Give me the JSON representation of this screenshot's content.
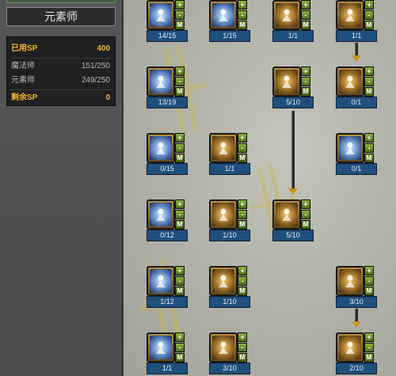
{
  "class_name": "元素师",
  "sp": {
    "used_label": "已用SP",
    "used_value": "400",
    "mage_label": "魔法师",
    "mage_value": "151/250",
    "elementalist_label": "元素师",
    "elementalist_value": "249/250",
    "remaining_label": "剩余SP",
    "remaining_value": "0"
  },
  "controls": {
    "plus": "+",
    "minus": "-",
    "master": "M"
  },
  "skills": [
    {
      "level": "14/15",
      "icon": "swirl-icon",
      "tone": "blue"
    },
    {
      "level": "1/15",
      "icon": "lightning-icon",
      "tone": "blue"
    },
    {
      "level": "1/1",
      "icon": "figure-icon",
      "tone": "gold"
    },
    {
      "level": "1/1",
      "icon": "figure-icon",
      "tone": "gold"
    },
    {
      "level": "13/19",
      "icon": "frost-star-icon",
      "tone": "blue"
    },
    {
      "level": "5/10",
      "icon": "fire-figure-icon",
      "tone": "gold"
    },
    {
      "level": "0/1",
      "icon": "orb-icon",
      "tone": "gold"
    },
    {
      "level": "0/15",
      "icon": "ghost-icon",
      "tone": "blue"
    },
    {
      "level": "1/1",
      "icon": "figure-icon",
      "tone": "gold"
    },
    {
      "level": "0/1",
      "icon": "runner-icon",
      "tone": "blue"
    },
    {
      "level": "0/12",
      "icon": "ice-pillar-icon",
      "tone": "blue"
    },
    {
      "level": "1/10",
      "icon": "fireball-icon",
      "tone": "gold"
    },
    {
      "level": "5/10",
      "icon": "burst-figure-icon",
      "tone": "gold"
    },
    {
      "level": "1/12",
      "icon": "ice-cross-icon",
      "tone": "blue"
    },
    {
      "level": "1/10",
      "icon": "fire-hand-icon",
      "tone": "gold"
    },
    {
      "level": "3/10",
      "icon": "meteor-icon",
      "tone": "gold"
    },
    {
      "level": "1/1",
      "icon": "ice-statue-icon",
      "tone": "blue"
    },
    {
      "level": "3/10",
      "icon": "fire-pillar-icon",
      "tone": "gold"
    },
    {
      "level": "2/10",
      "icon": "flame-icon",
      "tone": "gold"
    }
  ]
}
